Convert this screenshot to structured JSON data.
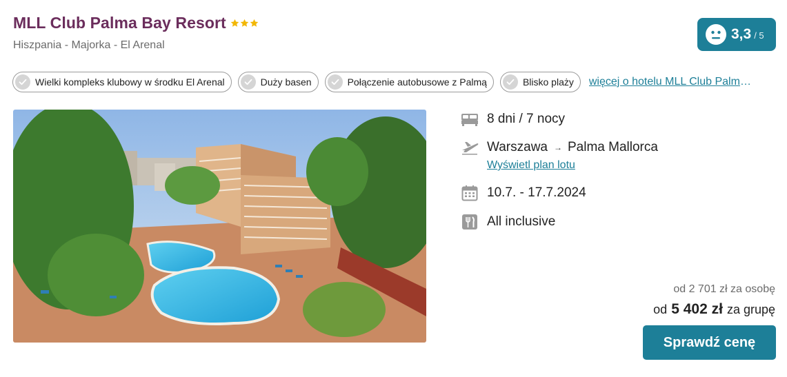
{
  "hotel": {
    "name": "MLL Club Palma Bay Resort",
    "star_count": 3,
    "location": "Hiszpania - Majorka - El Arenal"
  },
  "rating": {
    "value": "3,3",
    "scale": "/ 5",
    "icon": "neutral-face-icon"
  },
  "tags": [
    "Wielki kompleks klubowy w środku El Arenal",
    "Duży basen",
    "Połączenie autobusowe z Palmą",
    "Blisko plaży"
  ],
  "more_link": "więcej o hotelu MLL Club Palma Bay Resort",
  "details": {
    "duration": "8 dni / 7 nocy",
    "from": "Warszawa",
    "arrow": "→",
    "to": "Palma Mallorca",
    "flight_plan_link": "Wyświetl plan lotu",
    "dates": "10.7. - 17.7.2024",
    "board": "All inclusive"
  },
  "price": {
    "per_person": "od 2 701 zł za osobę",
    "group_prefix": "od",
    "group_amount": "5 402 zł",
    "group_suffix": "za grupę"
  },
  "cta_label": "Sprawdź cenę",
  "colors": {
    "title": "#6b2d5c",
    "accent": "#1d7f98",
    "star": "#f2b705"
  }
}
